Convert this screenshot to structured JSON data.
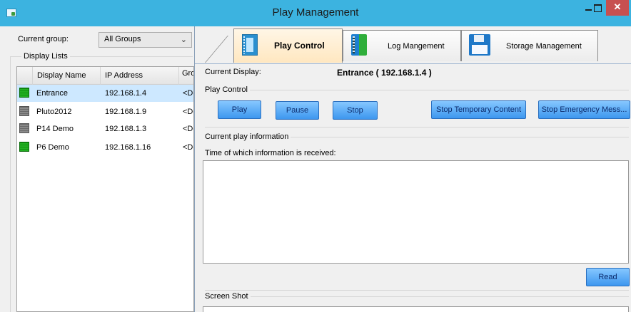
{
  "window": {
    "title": "Play Management",
    "minimize_glyph": "",
    "maximize_glyph": "",
    "close_glyph": "✕"
  },
  "left": {
    "current_group_label": "Current group:",
    "group_select_value": "All Groups",
    "display_lists_label": "Display Lists",
    "columns": [
      "Display Name",
      "IP Address",
      "Gro"
    ],
    "rows": [
      {
        "name": "Entrance",
        "ip": "192.168.1.4",
        "group": "<De",
        "status": "online",
        "selected": true
      },
      {
        "name": "Pluto2012",
        "ip": "192.168.1.9",
        "group": "<De",
        "status": "offline",
        "selected": false
      },
      {
        "name": "P14 Demo",
        "ip": "192.168.1.3",
        "group": "<De",
        "status": "offline",
        "selected": false
      },
      {
        "name": "P6 Demo",
        "ip": "192.168.1.16",
        "group": "<De",
        "status": "online",
        "selected": false
      }
    ]
  },
  "tabs": [
    {
      "label": "Play Control",
      "icon": "film-icon",
      "active": true
    },
    {
      "label": "Log Mangement",
      "icon": "log-book-icon",
      "active": false
    },
    {
      "label": "Storage Management",
      "icon": "floppy-disk-icon",
      "active": false
    }
  ],
  "play_control": {
    "current_display_label": "Current Display:",
    "current_display_value": "Entrance  ( 192.168.1.4 )",
    "section_label": "Play Control",
    "buttons": {
      "play": "Play",
      "pause": "Pause",
      "stop": "Stop",
      "stop_temporary": "Stop Temporary Content",
      "stop_emergency": "Stop Emergency Mess..."
    },
    "current_info_label": "Current play information",
    "time_received_label": "Time of which information is received:",
    "read_button": "Read",
    "screen_shot_label": "Screen Shot"
  },
  "colors": {
    "titlebar": "#3cb3e0",
    "button_blue": "#3d97ef",
    "selected_row": "#cde8ff",
    "online_green": "#22b022",
    "offline_gray": "#8a8a8a",
    "close_red": "#c75050"
  }
}
